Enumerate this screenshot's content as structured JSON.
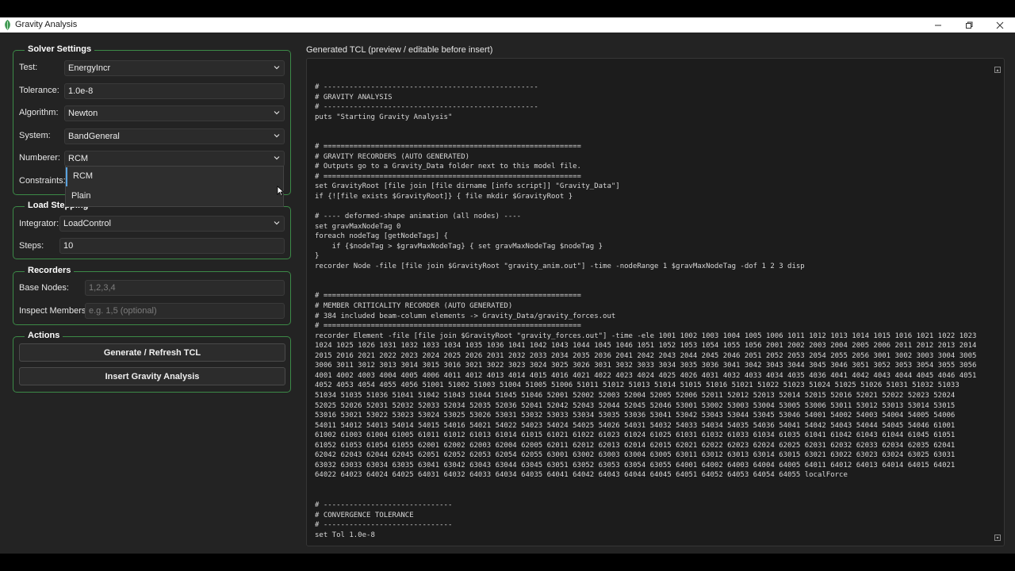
{
  "window": {
    "title": "Gravity Analysis",
    "controls": [
      "minimize-icon",
      "maximize-icon",
      "close-icon"
    ]
  },
  "solver": {
    "title": "Solver Settings",
    "test_label": "Test:",
    "test_value": "EnergyIncr",
    "tolerance_label": "Tolerance:",
    "tolerance_value": "1.0e-8",
    "algorithm_label": "Algorithm:",
    "algorithm_value": "Newton",
    "system_label": "System:",
    "system_value": "BandGeneral",
    "numberer_label": "Numberer:",
    "numberer_value": "RCM",
    "constraints_label": "Constraints:",
    "numberer_options": [
      "RCM",
      "Plain"
    ]
  },
  "load": {
    "title": "Load Stepping",
    "integrator_label": "Integrator:",
    "integrator_value": "LoadControl",
    "steps_label": "Steps:",
    "steps_value": "10"
  },
  "recorders": {
    "title": "Recorders",
    "base_nodes_label": "Base Nodes:",
    "base_nodes_placeholder": "1,2,3,4",
    "inspect_label": "Inspect Members:",
    "inspect_placeholder": "e.g. 1,5  (optional)"
  },
  "actions": {
    "title": "Actions",
    "generate_label": "Generate / Refresh TCL",
    "insert_label": "Insert Gravity Analysis"
  },
  "code": {
    "label": "Generated TCL (preview / editable before insert)",
    "lines": [
      "# --------------------------------------------------",
      "# GRAVITY ANALYSIS",
      "# --------------------------------------------------",
      "puts \"Starting Gravity Analysis\"",
      "",
      "",
      "# ============================================================",
      "# GRAVITY RECORDERS (AUTO GENERATED)",
      "# Outputs go to a Gravity_Data folder next to this model file.",
      "# ============================================================",
      "set GravityRoot [file join [file dirname [info script]] \"Gravity_Data\"]",
      "if {![file exists $GravityRoot]} { file mkdir $GravityRoot }",
      "",
      "# ---- deformed-shape animation (all nodes) ----",
      "set gravMaxNodeTag 0",
      "foreach nodeTag [getNodeTags] {",
      "    if {$nodeTag > $gravMaxNodeTag} { set gravMaxNodeTag $nodeTag }",
      "}",
      "recorder Node -file [file join $GravityRoot \"gravity_anim.out\"] -time -nodeRange 1 $gravMaxNodeTag -dof 1 2 3 disp",
      "",
      "",
      "# ============================================================",
      "# MEMBER CRITICALITY RECORDER (AUTO GENERATED)",
      "# 384 included beam-column elements -> Gravity_Data/gravity_forces.out",
      "# ============================================================",
      "recorder Element -file [file join $GravityRoot \"gravity_forces.out\"] -time -ele 1001 1002 1003 1004 1005 1006 1011 1012 1013 1014 1015 1016 1021 1022 1023",
      "1024 1025 1026 1031 1032 1033 1034 1035 1036 1041 1042 1043 1044 1045 1046 1051 1052 1053 1054 1055 1056 2001 2002 2003 2004 2005 2006 2011 2012 2013 2014",
      "2015 2016 2021 2022 2023 2024 2025 2026 2031 2032 2033 2034 2035 2036 2041 2042 2043 2044 2045 2046 2051 2052 2053 2054 2055 2056 3001 3002 3003 3004 3005",
      "3006 3011 3012 3013 3014 3015 3016 3021 3022 3023 3024 3025 3026 3031 3032 3033 3034 3035 3036 3041 3042 3043 3044 3045 3046 3051 3052 3053 3054 3055 3056",
      "4001 4002 4003 4004 4005 4006 4011 4012 4013 4014 4015 4016 4021 4022 4023 4024 4025 4026 4031 4032 4033 4034 4035 4036 4041 4042 4043 4044 4045 4046 4051",
      "4052 4053 4054 4055 4056 51001 51002 51003 51004 51005 51006 51011 51012 51013 51014 51015 51016 51021 51022 51023 51024 51025 51026 51031 51032 51033",
      "51034 51035 51036 51041 51042 51043 51044 51045 51046 52001 52002 52003 52004 52005 52006 52011 52012 52013 52014 52015 52016 52021 52022 52023 52024",
      "52025 52026 52031 52032 52033 52034 52035 52036 52041 52042 52043 52044 52045 52046 53001 53002 53003 53004 53005 53006 53011 53012 53013 53014 53015",
      "53016 53021 53022 53023 53024 53025 53026 53031 53032 53033 53034 53035 53036 53041 53042 53043 53044 53045 53046 54001 54002 54003 54004 54005 54006",
      "54011 54012 54013 54014 54015 54016 54021 54022 54023 54024 54025 54026 54031 54032 54033 54034 54035 54036 54041 54042 54043 54044 54045 54046 61001",
      "61002 61003 61004 61005 61011 61012 61013 61014 61015 61021 61022 61023 61024 61025 61031 61032 61033 61034 61035 61041 61042 61043 61044 61045 61051",
      "61052 61053 61054 61055 62001 62002 62003 62004 62005 62011 62012 62013 62014 62015 62021 62022 62023 62024 62025 62031 62032 62033 62034 62035 62041",
      "62042 62043 62044 62045 62051 62052 62053 62054 62055 63001 63002 63003 63004 63005 63011 63012 63013 63014 63015 63021 63022 63023 63024 63025 63031",
      "63032 63033 63034 63035 63041 63042 63043 63044 63045 63051 63052 63053 63054 63055 64001 64002 64003 64004 64005 64011 64012 64013 64014 64015 64021",
      "64022 64023 64024 64025 64031 64032 64033 64034 64035 64041 64042 64043 64044 64045 64051 64052 64053 64054 64055 localForce",
      "",
      "",
      "# ------------------------------",
      "# CONVERGENCE TOLERANCE",
      "# ------------------------------",
      "set Tol 1.0e-8"
    ]
  },
  "colors": {
    "accent_border": "#3c8a47",
    "background": "#232323",
    "code_background": "#1c1c1c"
  }
}
